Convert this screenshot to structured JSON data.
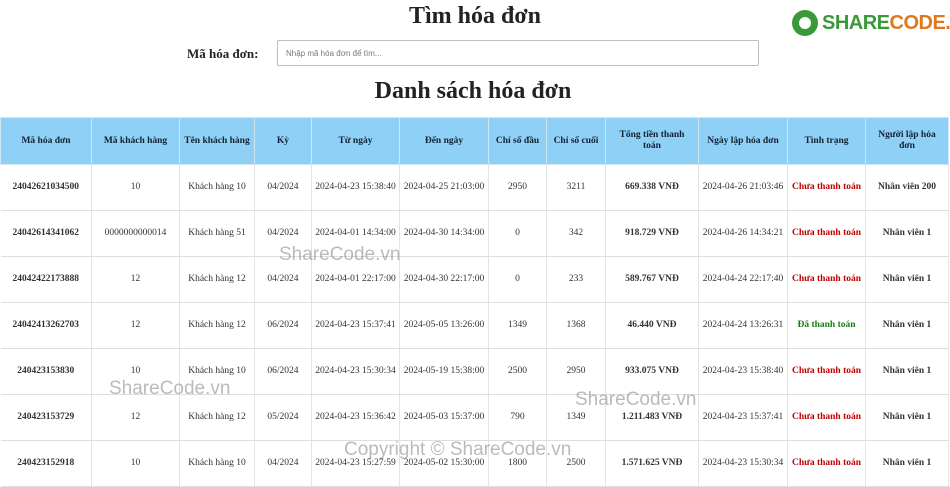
{
  "brand": {
    "part1": "SHARE",
    "part2": "CODE.vn"
  },
  "search": {
    "title": "Tìm hóa đơn",
    "label": "Mã hóa đơn:",
    "placeholder": "Nhập mã hóa đơn để tìm...",
    "value": ""
  },
  "list": {
    "title": "Danh sách hóa đơn"
  },
  "columns": [
    "Mã hóa đơn",
    "Mã khách hàng",
    "Tên khách hàng",
    "Kỳ",
    "Từ ngày",
    "Đến ngày",
    "Chỉ số đầu",
    "Chỉ số cuối",
    "Tổng tiền thanh toán",
    "Ngày lập hóa đơn",
    "Tình trạng",
    "Người lập hóa đơn"
  ],
  "rows": [
    {
      "id": "24042621034500",
      "customer_id": "10",
      "customer_name": "Khách hàng 10",
      "period": "04/2024",
      "from": "2024-04-23 15:38:40",
      "to": "2024-04-25 21:03:00",
      "start_index": "2950",
      "end_index": "3211",
      "total": "669.338 VNĐ",
      "created": "2024-04-26 21:03:46",
      "status": "Chưa thanh toán",
      "status_type": "unpaid",
      "creator": "Nhân viên 200"
    },
    {
      "id": "24042614341062",
      "customer_id": "0000000000014",
      "customer_name": "Khách hàng 51",
      "period": "04/2024",
      "from": "2024-04-01 14:34:00",
      "to": "2024-04-30 14:34:00",
      "start_index": "0",
      "end_index": "342",
      "total": "918.729 VNĐ",
      "created": "2024-04-26 14:34:21",
      "status": "Chưa thanh toán",
      "status_type": "unpaid",
      "creator": "Nhân viên 1"
    },
    {
      "id": "24042422173888",
      "customer_id": "12",
      "customer_name": "Khách hàng 12",
      "period": "04/2024",
      "from": "2024-04-01 22:17:00",
      "to": "2024-04-30 22:17:00",
      "start_index": "0",
      "end_index": "233",
      "total": "589.767 VNĐ",
      "created": "2024-04-24 22:17:40",
      "status": "Chưa thanh toán",
      "status_type": "unpaid",
      "creator": "Nhân viên 1"
    },
    {
      "id": "24042413262703",
      "customer_id": "12",
      "customer_name": "Khách hàng 12",
      "period": "06/2024",
      "from": "2024-04-23 15:37:41",
      "to": "2024-05-05 13:26:00",
      "start_index": "1349",
      "end_index": "1368",
      "total": "46.440 VNĐ",
      "created": "2024-04-24 13:26:31",
      "status": "Đã thanh toán",
      "status_type": "paid",
      "creator": "Nhân viên 1"
    },
    {
      "id": "240423153830",
      "customer_id": "10",
      "customer_name": "Khách hàng 10",
      "period": "06/2024",
      "from": "2024-04-23 15:30:34",
      "to": "2024-05-19 15:38:00",
      "start_index": "2500",
      "end_index": "2950",
      "total": "933.075 VNĐ",
      "created": "2024-04-23 15:38:40",
      "status": "Chưa thanh toán",
      "status_type": "unpaid",
      "creator": "Nhân viên 1"
    },
    {
      "id": "240423153729",
      "customer_id": "12",
      "customer_name": "Khách hàng 12",
      "period": "05/2024",
      "from": "2024-04-23 15:36:42",
      "to": "2024-05-03 15:37:00",
      "start_index": "790",
      "end_index": "1349",
      "total": "1.211.483 VNĐ",
      "created": "2024-04-23 15:37:41",
      "status": "Chưa thanh toán",
      "status_type": "unpaid",
      "creator": "Nhân viên 1"
    },
    {
      "id": "240423152918",
      "customer_id": "10",
      "customer_name": "Khách hàng 10",
      "period": "04/2024",
      "from": "2024-04-23 15:27:59",
      "to": "2024-05-02 15:30:00",
      "start_index": "1800",
      "end_index": "2500",
      "total": "1.571.625 VNĐ",
      "created": "2024-04-23 15:30:34",
      "status": "Chưa thanh toán",
      "status_type": "unpaid",
      "creator": "Nhân viên 1"
    }
  ],
  "watermarks": [
    "ShareCode.vn",
    "ShareCode.vn",
    "ShareCode.vn",
    "Copyright © ShareCode.vn"
  ],
  "colors": {
    "header_bg": "#8fd0f6",
    "invoice_id": "#c00000",
    "unpaid": "#c00000",
    "paid": "#1b7a1b",
    "brand_green": "#3a9a3a",
    "brand_orange": "#e0781c"
  }
}
